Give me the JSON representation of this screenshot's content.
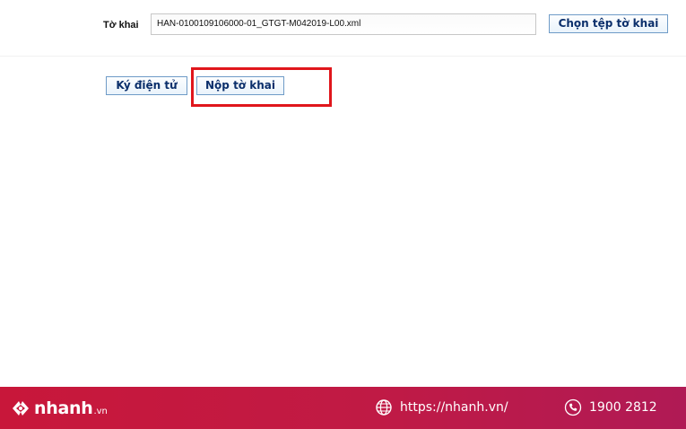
{
  "form": {
    "file_label": "Tờ khai",
    "file_value": "HAN-0100109106000-01_GTGT-M042019-L00.xml",
    "choose_button": "Chọn tệp tờ khai"
  },
  "actions": {
    "sign_button": "Ký điện tử",
    "submit_button": "Nộp tờ khai"
  },
  "footer": {
    "logo_text": "nhanh",
    "logo_suffix": ".vn",
    "website": "https://nhanh.vn/",
    "phone": "1900 2812",
    "icons": [
      "nhanh-logo-icon",
      "globe-icon",
      "phone-icon"
    ]
  },
  "colors": {
    "highlight": "#e0161c",
    "footer": "#c8173a",
    "button_border": "#6f9bc7"
  }
}
